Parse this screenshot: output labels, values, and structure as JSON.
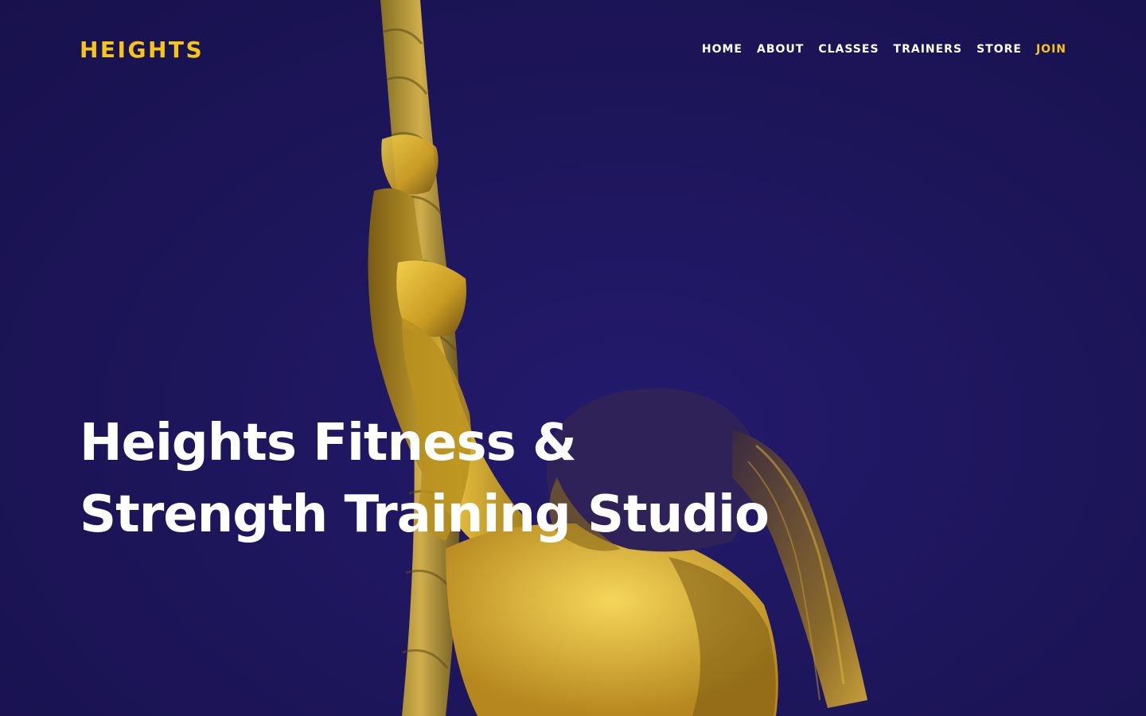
{
  "brand": {
    "logo": "HEIGHTS"
  },
  "nav": {
    "items": [
      {
        "label": "HOME"
      },
      {
        "label": "ABOUT"
      },
      {
        "label": "CLASSES"
      },
      {
        "label": "TRAINERS"
      },
      {
        "label": "STORE"
      },
      {
        "label": "JOIN",
        "accent": true
      }
    ]
  },
  "hero": {
    "headline_line1": "Heights Fitness &",
    "headline_line2": "Strength Training Studio",
    "image": "duotone photo of athlete climbing a rope"
  },
  "colors": {
    "background": "#1d1559",
    "accent": "#f5c518",
    "text": "#ffffff"
  }
}
